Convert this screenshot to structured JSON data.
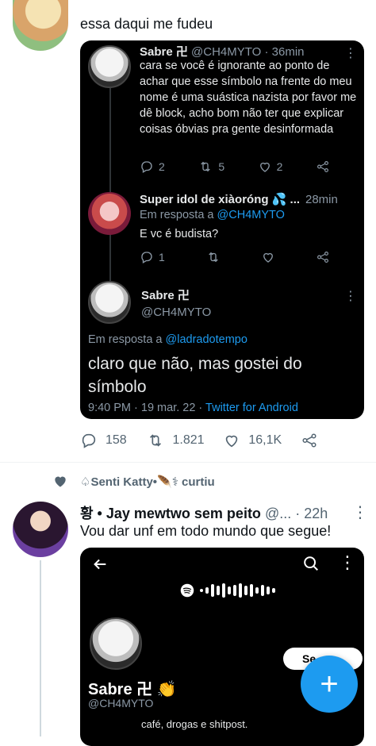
{
  "top_tweet": {
    "text": "essa daqui me fudeu"
  },
  "quote": {
    "t1": {
      "name": "Sabre 卍",
      "handle": "@CH4MYTO",
      "time": "· 36min",
      "text": "cara se você é ignorante ao ponto de achar que esse símbolo na frente do meu nome é uma suástica nazista por favor me dê block, acho bom não ter que explicar coisas óbvias pra gente desinformada",
      "replies": "2",
      "retweets": "5",
      "likes": "2"
    },
    "t2": {
      "name": "Super idol de xiàoróng 💦 ...",
      "time": "28min",
      "reply_prefix": "Em resposta a",
      "reply_handle": "@CH4MYTO",
      "text": "E vc é budista?",
      "replies": "1"
    },
    "t3": {
      "name": "Sabre 卍",
      "handle": "@CH4MYTO",
      "reply_prefix": "Em resposta a",
      "reply_handle": "@ladradotempo",
      "text": "claro que não, mas gostei do símbolo",
      "time": "9:40 PM · 19 mar. 22 ·",
      "source": "Twitter for Android"
    }
  },
  "top_stats": {
    "replies": "158",
    "retweets": "1.821",
    "likes": "16,1K"
  },
  "second": {
    "liked_by": "♤Senti Katty•🪶⚕ curtiu",
    "name": "황 • Jay mewtwo sem peito",
    "handle": "@...",
    "time": "· 22h",
    "text": "Vou dar unf em todo mundo que segue!",
    "media": {
      "profile_name": "Sabre 卍",
      "profile_emoji": "👏",
      "profile_handle": "@CH4MYTO",
      "bio": "café, drogas e shitpost.",
      "follow_label": "Se"
    }
  },
  "fab": {
    "label": "+"
  },
  "colors": {
    "accent": "#1d9bf0",
    "card_bg": "#000000"
  }
}
